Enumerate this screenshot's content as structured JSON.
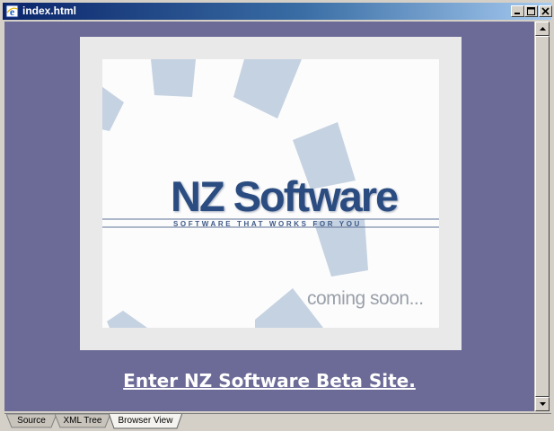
{
  "window": {
    "title": "index.html",
    "minimize_glyph": "_",
    "maximize_glyph": "□",
    "close_glyph": "×"
  },
  "splash": {
    "brand": "NZ Software",
    "tagline": "SOFTWARE THAT WORKS FOR YOU",
    "coming_soon": "coming soon..."
  },
  "link": {
    "enter": "Enter NZ Software Beta Site."
  },
  "tabs": [
    {
      "label": "Source",
      "active": false
    },
    {
      "label": "XML Tree",
      "active": false
    },
    {
      "label": "Browser View",
      "active": true
    }
  ],
  "colors": {
    "page_background": "#6c6a97",
    "brand_blue": "#2a4c80",
    "titlebar_start": "#0a246a",
    "titlebar_end": "#a6caf0"
  }
}
